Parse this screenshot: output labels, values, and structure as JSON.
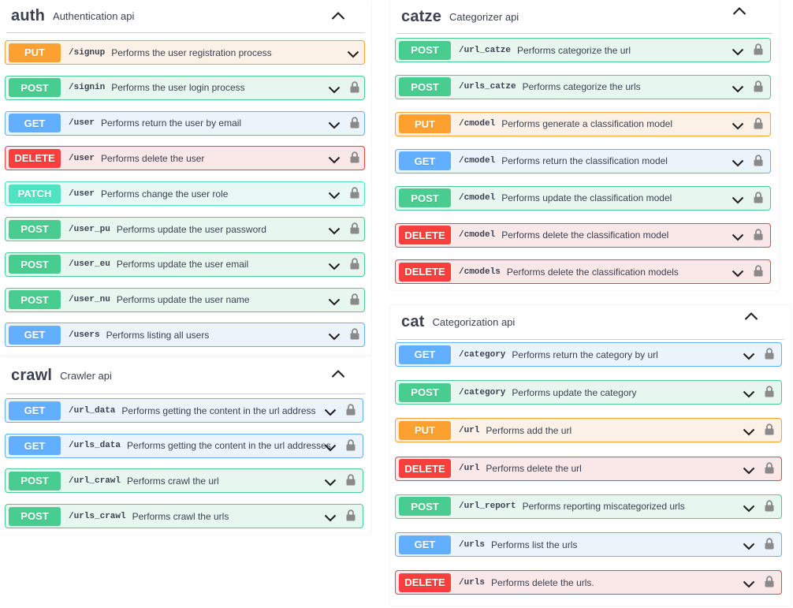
{
  "colors": {
    "put": "#fca130",
    "post": "#49cc90",
    "get": "#61affe",
    "delete": "#f93e3e",
    "patch": "#50e3c2"
  },
  "icons": {
    "collapse": "chevron-up-icon",
    "expand": "chevron-down-icon",
    "lock": "lock-icon"
  },
  "auth": {
    "name": "auth",
    "description": "Authentication api",
    "ops": [
      {
        "method": "PUT",
        "path": "/signup",
        "summary": "Performs the user registration process"
      },
      {
        "method": "POST",
        "path": "/signin",
        "summary": "Performs the user login process"
      },
      {
        "method": "GET",
        "path": "/user",
        "summary": "Performs return the user by email"
      },
      {
        "method": "DELETE",
        "path": "/user",
        "summary": "Performs delete the user"
      },
      {
        "method": "PATCH",
        "path": "/user",
        "summary": "Performs change the user role"
      },
      {
        "method": "POST",
        "path": "/user_pu",
        "summary": "Performs update the user password"
      },
      {
        "method": "POST",
        "path": "/user_eu",
        "summary": "Performs update the user email"
      },
      {
        "method": "POST",
        "path": "/user_nu",
        "summary": "Performs update the user name"
      },
      {
        "method": "GET",
        "path": "/users",
        "summary": "Performs listing all users"
      }
    ]
  },
  "crawl": {
    "name": "crawl",
    "description": "Crawler api",
    "ops": [
      {
        "method": "GET",
        "path": "/url_data",
        "summary": "Performs getting the content in the url address"
      },
      {
        "method": "GET",
        "path": "/urls_data",
        "summary": "Performs getting the content in the url addresses"
      },
      {
        "method": "POST",
        "path": "/url_crawl",
        "summary": "Performs crawl the url"
      },
      {
        "method": "POST",
        "path": "/urls_crawl",
        "summary": "Performs crawl the urls"
      }
    ]
  },
  "catze": {
    "name": "catze",
    "description": "Categorizer api",
    "ops": [
      {
        "method": "POST",
        "path": "/url_catze",
        "summary": "Performs categorize the url"
      },
      {
        "method": "POST",
        "path": "/urls_catze",
        "summary": "Performs categorize the urls"
      },
      {
        "method": "PUT",
        "path": "/cmodel",
        "summary": "Performs generate a classification model"
      },
      {
        "method": "GET",
        "path": "/cmodel",
        "summary": "Performs return the classification model"
      },
      {
        "method": "POST",
        "path": "/cmodel",
        "summary": "Performs update the classification model"
      },
      {
        "method": "DELETE",
        "path": "/cmodel",
        "summary": "Performs delete the classification model"
      },
      {
        "method": "DELETE",
        "path": "/cmodels",
        "summary": "Performs delete the classification models"
      }
    ]
  },
  "cat": {
    "name": "cat",
    "description": "Categorization api",
    "ops": [
      {
        "method": "GET",
        "path": "/category",
        "summary": "Performs return the category by url"
      },
      {
        "method": "POST",
        "path": "/category",
        "summary": "Performs update the category"
      },
      {
        "method": "PUT",
        "path": "/url",
        "summary": "Performs add the url"
      },
      {
        "method": "DELETE",
        "path": "/url",
        "summary": "Performs delete the url"
      },
      {
        "method": "POST",
        "path": "/url_report",
        "summary": "Performs reporting miscategorized urls"
      },
      {
        "method": "GET",
        "path": "/urls",
        "summary": "Performs list the urls"
      },
      {
        "method": "DELETE",
        "path": "/urls",
        "summary": "Performs delete the urls."
      }
    ]
  }
}
